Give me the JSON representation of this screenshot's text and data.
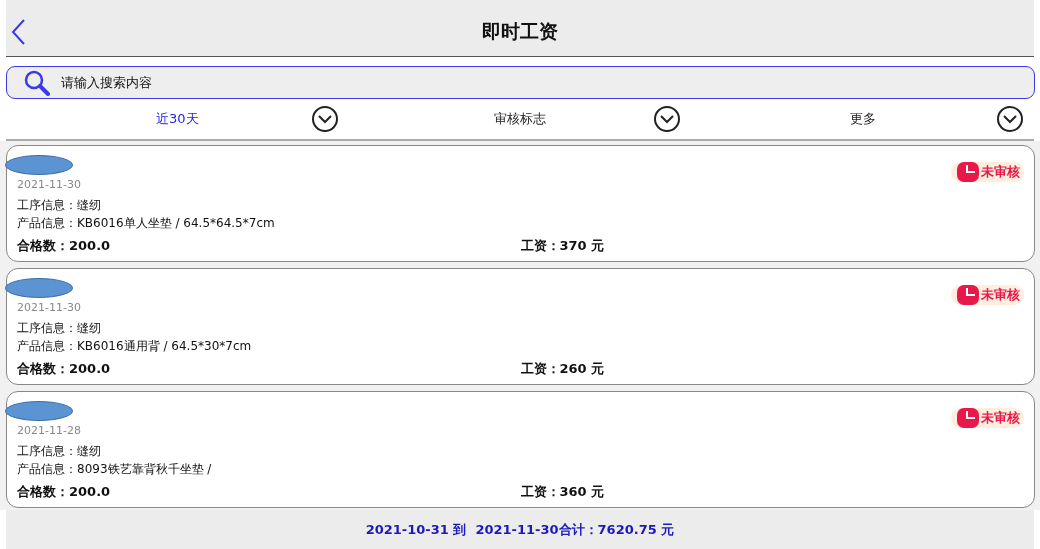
{
  "header": {
    "title": "即时工资"
  },
  "search": {
    "placeholder": "请输入搜索内容"
  },
  "filters": [
    {
      "label": "近30天",
      "selected": true
    },
    {
      "label": "审核标志",
      "selected": false
    },
    {
      "label": "更多",
      "selected": false
    }
  ],
  "records": [
    {
      "name_redacted": true,
      "date": "2021-11-30",
      "process": "工序信息：缝纫",
      "product": "产品信息：KB6016单人坐垫 / 64.5*64.5*7cm",
      "qualified": "合格数：200.0",
      "wage": "工资：370 元",
      "status": "未审核",
      "approved": false
    },
    {
      "name_redacted": true,
      "date": "2021-11-30",
      "process": "工序信息：缝纫",
      "product": "产品信息：KB6016通用背 / 64.5*30*7cm",
      "qualified": "合格数：200.0",
      "wage": "工资：260 元",
      "status": "未审核",
      "approved": false
    },
    {
      "name_redacted": true,
      "date": "2021-11-28",
      "process": "工序信息：缝纫",
      "product": "产品信息：8093铁艺靠背秋千坐垫 /",
      "qualified": "合格数：200.0",
      "wage": "工资：360 元",
      "status": "未审核",
      "approved": false
    }
  ],
  "footer": {
    "summary": "2021-10-31 到  2021-11-30合计：7620.75 元"
  }
}
